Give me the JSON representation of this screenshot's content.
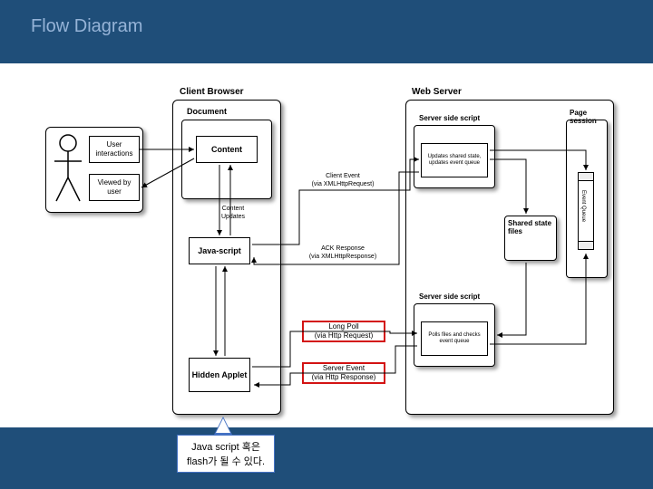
{
  "title": "Flow Diagram",
  "actor": {
    "label1": "User interactions",
    "label2": "Viewed by user"
  },
  "client": {
    "title": "Client Browser",
    "doc_title": "Document",
    "content": "Content",
    "js": "Java-script",
    "applet": "Hidden Applet",
    "upd": "Content Updates"
  },
  "mid": {
    "ce": "Client Event\n(via XMLHttpRequest)",
    "ack": "ACK Response\n(via XMLHttpResponse)",
    "lp": "Long Poll\n(via Http Request)",
    "se": "Server Event\n(via Http Response)"
  },
  "server": {
    "title": "Web Server",
    "s1": "Server side script",
    "s1b": "Updates shared state, updates event queue",
    "sf": "Shared state files",
    "s2": "Server side script",
    "s2b": "Polls files and checks event queue",
    "ps": "Page session",
    "eq": "Event Queue"
  },
  "callout": "Java script 혹은\nflash가 될 수 있다.",
  "chart_data": {
    "type": "flow-diagram",
    "nodes": [
      {
        "id": "user",
        "label": "User"
      },
      {
        "id": "ui",
        "label": "User interactions"
      },
      {
        "id": "vu",
        "label": "Viewed by user"
      },
      {
        "id": "content",
        "label": "Content"
      },
      {
        "id": "js",
        "label": "Javascript"
      },
      {
        "id": "applet",
        "label": "Hidden Applet"
      },
      {
        "id": "ss1",
        "label": "Server side script (top)"
      },
      {
        "id": "ss1b",
        "label": "Updates shared state, updates event queue"
      },
      {
        "id": "ssf",
        "label": "Shared state files"
      },
      {
        "id": "ss2",
        "label": "Server side script (bottom)"
      },
      {
        "id": "ss2b",
        "label": "Polls files and checks event queue"
      },
      {
        "id": "ps",
        "label": "Page session"
      },
      {
        "id": "eq",
        "label": "Event Queue"
      }
    ],
    "edges": [
      {
        "from": "ui",
        "to": "content",
        "label": ""
      },
      {
        "from": "content",
        "to": "vu",
        "label": ""
      },
      {
        "from": "content",
        "to": "js",
        "label": "Content Updates",
        "dir": "both"
      },
      {
        "from": "js",
        "to": "ss1",
        "label": "Client Event (via XMLHttpRequest)"
      },
      {
        "from": "ss1",
        "to": "js",
        "label": "ACK Response (via XMLHttpResponse)"
      },
      {
        "from": "applet",
        "to": "ss2",
        "label": "Long Poll (via Http Request)"
      },
      {
        "from": "ss2",
        "to": "applet",
        "label": "Server Event (via Http Response)"
      },
      {
        "from": "js",
        "to": "applet",
        "label": "",
        "dir": "both"
      },
      {
        "from": "ss1b",
        "to": "ssf",
        "label": ""
      },
      {
        "from": "ssf",
        "to": "ss2b",
        "label": ""
      },
      {
        "from": "ss2b",
        "to": "eq",
        "label": ""
      },
      {
        "from": "ss1b",
        "to": "eq",
        "label": ""
      }
    ],
    "containers": [
      {
        "id": "client",
        "label": "Client Browser",
        "children": [
          "content",
          "js",
          "applet"
        ]
      },
      {
        "id": "document",
        "label": "Document",
        "children": [
          "content"
        ]
      },
      {
        "id": "webserver",
        "label": "Web Server",
        "children": [
          "ss1",
          "ss1b",
          "ssf",
          "ss2",
          "ss2b",
          "ps",
          "eq"
        ]
      }
    ],
    "highlighted": [
      "lp",
      "se"
    ]
  }
}
